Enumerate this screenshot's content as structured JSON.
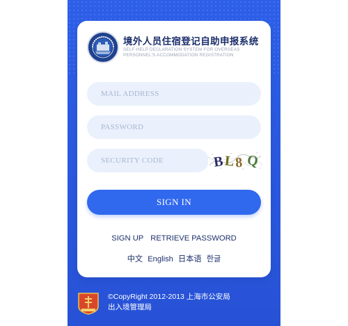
{
  "header": {
    "title_cn": "境外人员住宿登记自助申报系统",
    "title_en_line1": "SELF-HELP DECLARATION SYSTEM FOR OVERSEAS",
    "title_en_line2": "PERSONNEL'S ACCOMMODATION REGISTRATION",
    "logo_icon": "police-seal-icon"
  },
  "form": {
    "email_placeholder": "MAIL ADDRESS",
    "password_placeholder": "PASSWORD",
    "security_code_placeholder": "SECURITY CODE",
    "captcha_text": "BL8Q",
    "signin_label": "SIGN IN"
  },
  "links": {
    "sign_up": "SIGN UP",
    "retrieve_password": "RETRIEVE PASSWORD"
  },
  "languages": [
    "中文",
    "English",
    "日本语",
    "한글"
  ],
  "footer": {
    "line1": "©CopyRight 2012-2013 上海市公安局",
    "line2": "出入境管理局",
    "badge_icon": "police-badge-icon"
  },
  "colors": {
    "background_blue": "#2d5fe8",
    "button_blue": "#3068ee",
    "input_bg": "#eaf1fd",
    "title_navy": "#1d2f6b"
  }
}
